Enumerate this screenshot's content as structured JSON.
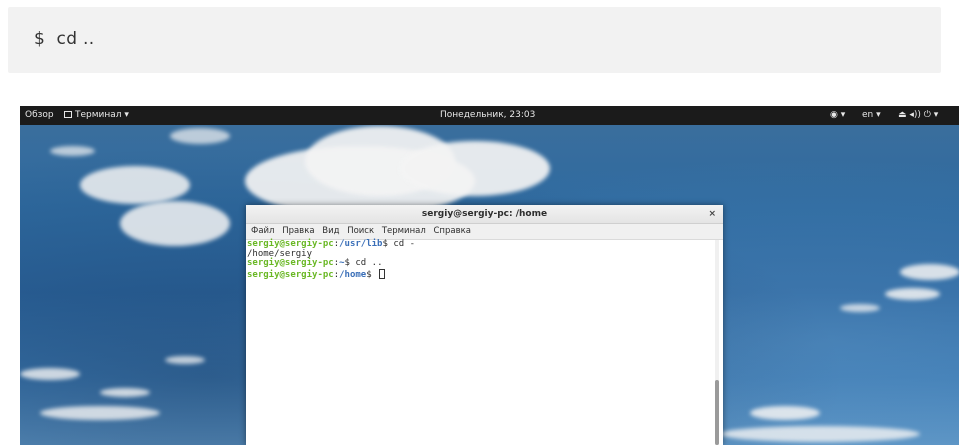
{
  "code_snippet": {
    "prompt": "$",
    "command": "cd .."
  },
  "topbar": {
    "activities": "Обзор",
    "app_menu": "Терминал ▾",
    "clock": "Понедельник, 23:03",
    "accessibility": "◉ ▾",
    "language": "en ▾",
    "status": "⏏ ◂)) ⏻ ▾"
  },
  "terminal": {
    "title": "sergiy@sergiy-pc: /home",
    "close": "×",
    "menu": [
      "Файл",
      "Правка",
      "Вид",
      "Поиск",
      "Терминал",
      "Справка"
    ],
    "lines": [
      {
        "user": "sergiy@sergiy-pc",
        "sep": ":",
        "path": "/usr/lib",
        "prompt": "$ ",
        "cmd": "cd -"
      },
      {
        "output": "/home/sergiy"
      },
      {
        "user": "sergiy@sergiy-pc",
        "sep": ":",
        "path": "~",
        "prompt": "$ ",
        "cmd": "cd .."
      },
      {
        "user": "sergiy@sergiy-pc",
        "sep": ":",
        "path": "/home",
        "prompt": "$ ",
        "cmd": ""
      }
    ]
  }
}
